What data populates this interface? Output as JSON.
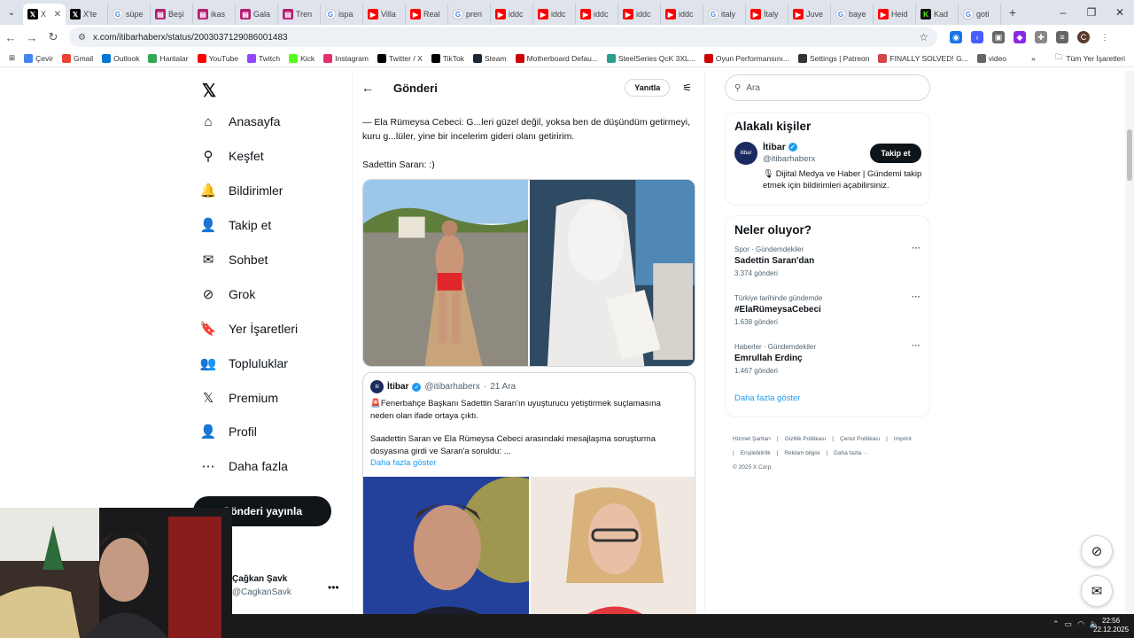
{
  "browser": {
    "tabs": [
      {
        "favicon": "x",
        "label": "X",
        "active": true
      },
      {
        "favicon": "x",
        "label": "X'te"
      },
      {
        "favicon": "g",
        "label": "süpe"
      },
      {
        "favicon": "tw",
        "label": "Beşi"
      },
      {
        "favicon": "tw",
        "label": "ikas"
      },
      {
        "favicon": "tw",
        "label": "Gala"
      },
      {
        "favicon": "tw",
        "label": "Tren"
      },
      {
        "favicon": "g",
        "label": "ispa"
      },
      {
        "favicon": "yt",
        "label": "Villa"
      },
      {
        "favicon": "yt",
        "label": "Real"
      },
      {
        "favicon": "g",
        "label": "pren"
      },
      {
        "favicon": "yt",
        "label": "iddc"
      },
      {
        "favicon": "yt",
        "label": "iddc"
      },
      {
        "favicon": "yt",
        "label": "iddc"
      },
      {
        "favicon": "yt",
        "label": "iddc"
      },
      {
        "favicon": "yt",
        "label": "iddc"
      },
      {
        "favicon": "g",
        "label": "italy"
      },
      {
        "favicon": "yt",
        "label": "İtaly"
      },
      {
        "favicon": "yt",
        "label": "Juve"
      },
      {
        "favicon": "g",
        "label": "baye"
      },
      {
        "favicon": "yt",
        "label": "Heid"
      },
      {
        "favicon": "kick",
        "label": "Kad"
      },
      {
        "favicon": "g",
        "label": "goti"
      }
    ],
    "url": "x.com/itibarhaberx/status/2003037129086001483",
    "bookmarks": [
      "Çevir",
      "Gmail",
      "Outlook",
      "Haritalar",
      "YouTube",
      "Twitch",
      "Kick",
      "Instagram",
      "Twitter / X",
      "TikTok",
      "Steam",
      "Motherboard Defau...",
      "SteelSeries QcK 3XL...",
      "Oyun Performansını...",
      "Settings | Patreon",
      "FINALLY SOLVED! G...",
      "video"
    ],
    "bookmarks_more": "»",
    "all_bookmarks": "Tüm Yer İşaretleri"
  },
  "sidebar": {
    "items": [
      {
        "icon": "home-icon",
        "glyph": "⌂",
        "label": "Anasayfa"
      },
      {
        "icon": "search-icon",
        "glyph": "⚲",
        "label": "Keşfet"
      },
      {
        "icon": "bell-icon",
        "glyph": "🔔",
        "label": "Bildirimler"
      },
      {
        "icon": "add-person-icon",
        "glyph": "👤",
        "label": "Takip et"
      },
      {
        "icon": "mail-icon",
        "glyph": "✉",
        "label": "Sohbet"
      },
      {
        "icon": "grok-icon",
        "glyph": "⊘",
        "label": "Grok"
      },
      {
        "icon": "bookmark-icon",
        "glyph": "🔖",
        "label": "Yer İşaretleri"
      },
      {
        "icon": "communities-icon",
        "glyph": "👥",
        "label": "Topluluklar"
      },
      {
        "icon": "x-premium-icon",
        "glyph": "𝕏",
        "label": "Premium"
      },
      {
        "icon": "profile-icon",
        "glyph": "👤",
        "label": "Profil"
      },
      {
        "icon": "more-icon",
        "glyph": "⋯",
        "label": "Daha fazla"
      }
    ],
    "post_button": "Gönderi yayınla",
    "account": {
      "name": "Çağkan Şavk",
      "handle": "@CagkanSavk"
    }
  },
  "post": {
    "header_title": "Gönderi",
    "reply_label": "Yanıtla",
    "text_lines": [
      "— Ela Rümeysa Cebeci: G...leri güzel değil, yoksa ben de düşündüm getirmeyi, kuru g...lüler, yine bir incelerim gideri olanı getiririm.",
      "Sadettin Saran: :)"
    ],
    "quote": {
      "name": "İtibar",
      "handle": "@itibarhaberx",
      "date": "21 Ara",
      "siren": "🚨",
      "body_1": "Fenerbahçe Başkanı Sadettin Saran'ın uyuşturucu yetiştirmek suçlamasına neden olan ifade ortaya çıktı.",
      "body_2": "Saadettin Saran ve Ela Rümeysa Cebeci arasındaki mesajlaşma soruşturma dosyasına girdi ve Saran'a soruldu:  ...",
      "show_more": "Daha fazla göster"
    }
  },
  "right": {
    "search_placeholder": "Ara",
    "related_title": "Alakalı kişiler",
    "related": {
      "avatar_text": "itibar",
      "name": "İtibar",
      "handle": "@itibarhaberx",
      "follow": "Takip et",
      "bio": "🎙 Dijital Medya ve Haber | Gündemi takip etmek için bildirimleri açabilirsiniz."
    },
    "trends_title": "Neler oluyor?",
    "trends": [
      {
        "category": "Spor · Gündemdekiler",
        "name": "Sadettin Saran'dan",
        "count": "3.374 gönderi"
      },
      {
        "category": "Türkiye tarihinde gündemde",
        "name": "#ElaRümeysaCebeci",
        "count": "1.638 gönderi"
      },
      {
        "category": "Haberler · Gündemdekiler",
        "name": "Emrullah Erdinç",
        "count": "1.467 gönderi"
      }
    ],
    "show_more": "Daha fazla göster",
    "footer": [
      "Hizmet Şartları",
      "|",
      "Gizlilik Politikası",
      "|",
      "Çerez Politikası",
      "|",
      "Imprint",
      "|",
      "Erişilebilirlik",
      "|",
      "Reklam bilgisi",
      "|",
      "Daha fazla ···",
      "© 2025 X Corp."
    ]
  },
  "taskbar": {
    "time": "22:56",
    "date": "22.12.2025"
  }
}
